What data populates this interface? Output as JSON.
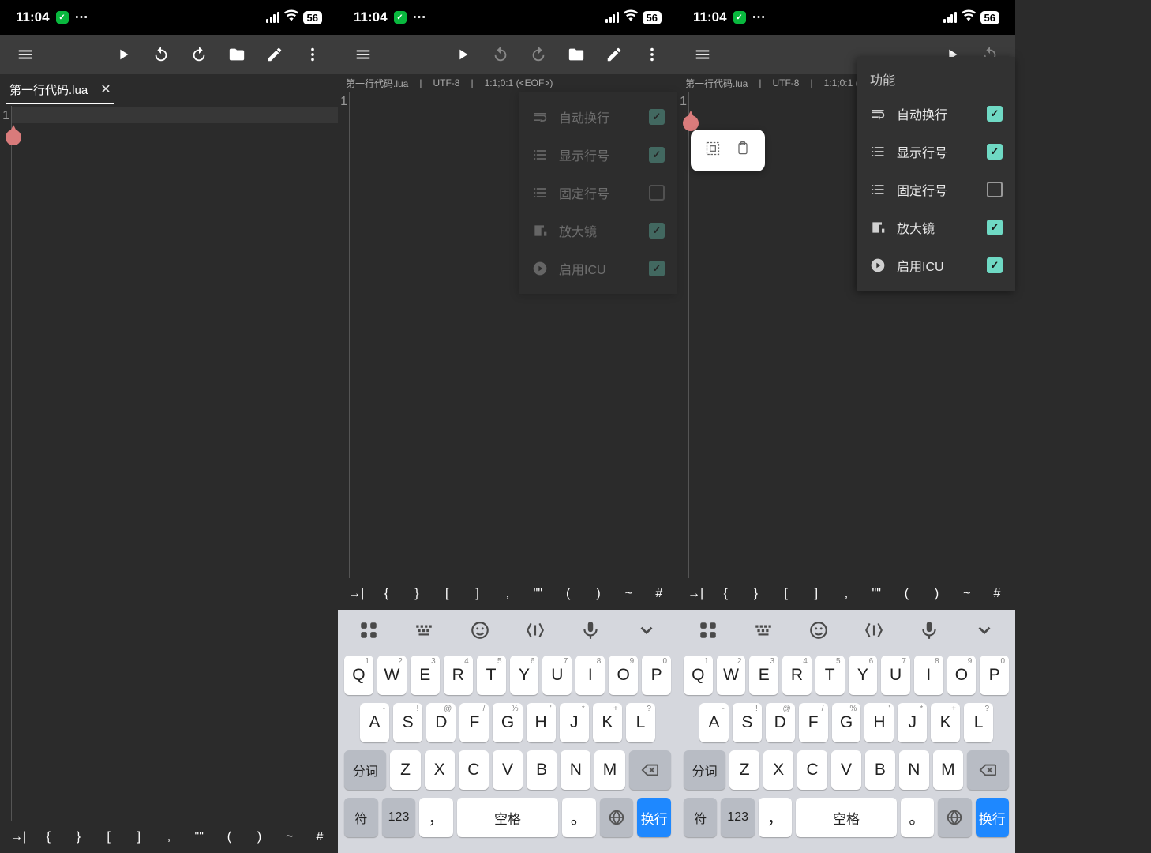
{
  "status": {
    "time": "11:04",
    "battery": "56"
  },
  "file": {
    "name": "第一行代码.lua",
    "encoding": "UTF-8",
    "position": "1:1;0:1 (<EOF>)"
  },
  "editor": {
    "line_number": "1"
  },
  "func_menu": {
    "title": "功能",
    "items": [
      {
        "label": "自动换行",
        "checked": true
      },
      {
        "label": "显示行号",
        "checked": true
      },
      {
        "label": "固定行号",
        "checked": false
      },
      {
        "label": "放大镜",
        "checked": true
      },
      {
        "label": "启用ICU",
        "checked": true
      }
    ]
  },
  "symbols": [
    "→|",
    "{",
    "}",
    "[",
    "]",
    ",",
    "\"\"",
    "(",
    ")",
    "~",
    "#"
  ],
  "keyboard": {
    "row1": [
      {
        "k": "Q",
        "s": "1"
      },
      {
        "k": "W",
        "s": "2"
      },
      {
        "k": "E",
        "s": "3"
      },
      {
        "k": "R",
        "s": "4"
      },
      {
        "k": "T",
        "s": "5"
      },
      {
        "k": "Y",
        "s": "6"
      },
      {
        "k": "U",
        "s": "7"
      },
      {
        "k": "I",
        "s": "8"
      },
      {
        "k": "O",
        "s": "9"
      },
      {
        "k": "P",
        "s": "0"
      }
    ],
    "row2": [
      {
        "k": "A",
        "s": "-"
      },
      {
        "k": "S",
        "s": "!"
      },
      {
        "k": "D",
        "s": "@"
      },
      {
        "k": "F",
        "s": "/"
      },
      {
        "k": "G",
        "s": "%"
      },
      {
        "k": "H",
        "s": "'"
      },
      {
        "k": "J",
        "s": "*"
      },
      {
        "k": "K",
        "s": "+"
      },
      {
        "k": "L",
        "s": "?"
      }
    ],
    "row3": [
      {
        "k": "Z"
      },
      {
        "k": "X"
      },
      {
        "k": "C"
      },
      {
        "k": "V"
      },
      {
        "k": "B"
      },
      {
        "k": "N"
      },
      {
        "k": "M"
      }
    ],
    "segment": "分词",
    "sym": "符",
    "num": "123",
    "comma": "，",
    "space": "空格",
    "period": "。",
    "enter": "换行"
  }
}
